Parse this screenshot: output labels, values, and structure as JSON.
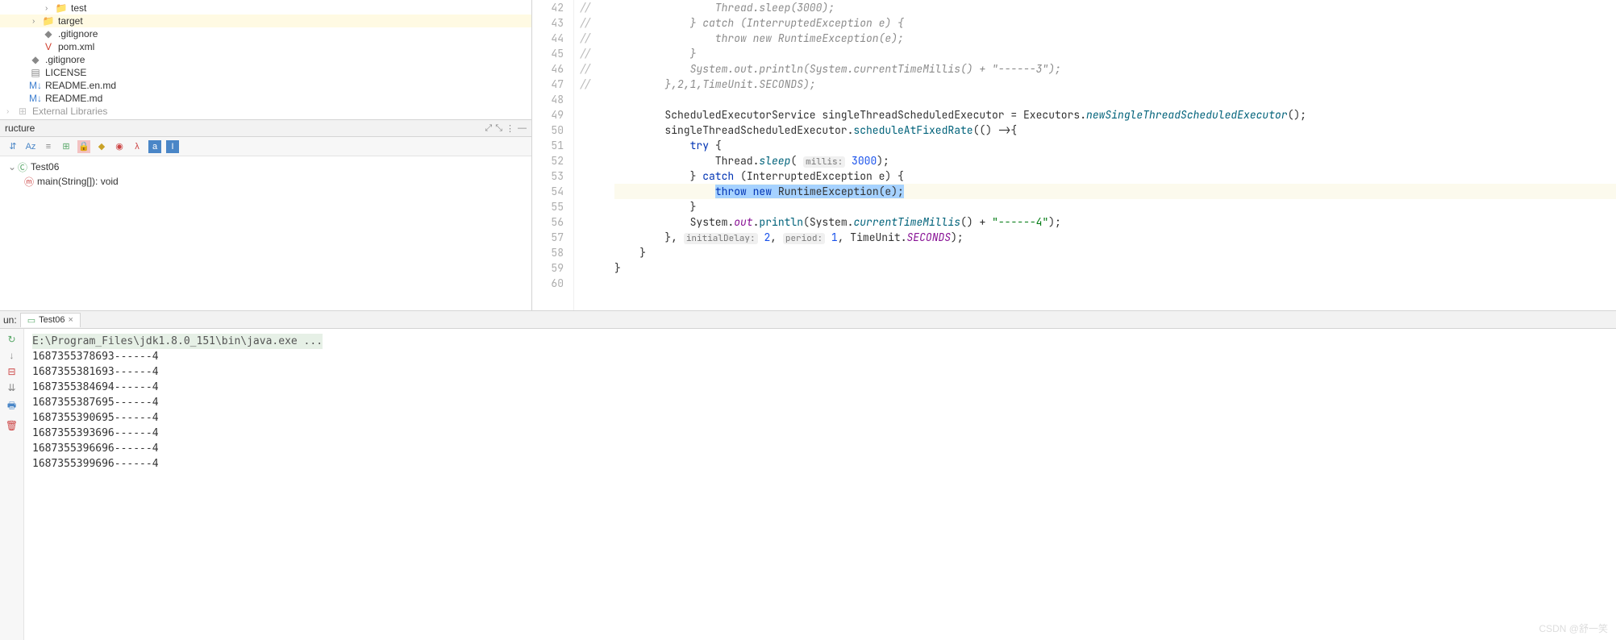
{
  "tree": {
    "items": [
      {
        "indent": 3,
        "arrow": "›",
        "iconClass": "folder-green",
        "glyph": "📁",
        "label": "test"
      },
      {
        "indent": 2,
        "arrow": "›",
        "iconClass": "folder-orange",
        "glyph": "📁",
        "label": "target",
        "sel": true
      },
      {
        "indent": 2,
        "arrow": "",
        "iconClass": "file-gray",
        "glyph": "◆",
        "label": ".gitignore"
      },
      {
        "indent": 2,
        "arrow": "",
        "iconClass": "file-red",
        "glyph": "V",
        "label": "pom.xml"
      },
      {
        "indent": 1,
        "arrow": "",
        "iconClass": "file-gray",
        "glyph": "◆",
        "label": ".gitignore"
      },
      {
        "indent": 1,
        "arrow": "",
        "iconClass": "file-gray",
        "glyph": "▤",
        "label": "LICENSE"
      },
      {
        "indent": 1,
        "arrow": "",
        "iconClass": "file-blue",
        "glyph": "M↓",
        "label": "README.en.md"
      },
      {
        "indent": 1,
        "arrow": "",
        "iconClass": "file-blue",
        "glyph": "M↓",
        "label": "README.md"
      },
      {
        "indent": 0,
        "arrow": "›",
        "iconClass": "file-gray",
        "glyph": "⊞",
        "label": "External Libraries",
        "faded": true
      }
    ]
  },
  "structure": {
    "title": "ructure",
    "className": "Test06",
    "method": "main(String[]): void"
  },
  "editor": {
    "startLine": 42,
    "lines": [
      {
        "n": 42,
        "prefix": "//",
        "html": "<span class='com'>                Thread.sleep(3000);</span>"
      },
      {
        "n": 43,
        "prefix": "//",
        "html": "<span class='com'>            } catch (InterruptedException e) {</span>"
      },
      {
        "n": 44,
        "prefix": "//",
        "html": "<span class='com'>                throw new RuntimeException(e);</span>"
      },
      {
        "n": 45,
        "prefix": "//",
        "html": "<span class='com'>            }</span>"
      },
      {
        "n": 46,
        "prefix": "//",
        "html": "<span class='com'>            System.out.println(System.currentTimeMillis() + \"------3\");</span>"
      },
      {
        "n": 47,
        "prefix": "//",
        "html": "<span class='com'>        },2,1,TimeUnit.SECONDS);</span>"
      },
      {
        "n": 48,
        "prefix": "",
        "html": ""
      },
      {
        "n": 49,
        "prefix": "",
        "html": "        ScheduledExecutorService singleThreadScheduledExecutor = Executors.<span class='methodi'>newSingleThreadScheduledExecutor</span>();"
      },
      {
        "n": 50,
        "prefix": "",
        "html": "        singleThreadScheduledExecutor.<span class='method'>scheduleAtFixedRate</span>(() -&gt;{"
      },
      {
        "n": 51,
        "prefix": "",
        "html": "            <span class='kw'>try</span> {"
      },
      {
        "n": 52,
        "prefix": "",
        "html": "                Thread.<span class='methodi'>sleep</span>( <span class='hint'>millis:</span> <span class='num'>3000</span>);"
      },
      {
        "n": 53,
        "prefix": "",
        "html": "            } <span class='kw'>catch</span> (InterruptedException e) {"
      },
      {
        "n": 54,
        "prefix": "",
        "hl": true,
        "html": "                <span class='sel-text'><span class='kw'>throw new</span> RuntimeException(e);</span>"
      },
      {
        "n": 55,
        "prefix": "",
        "html": "            }"
      },
      {
        "n": 56,
        "prefix": "",
        "html": "            System.<span class='field'>out</span>.<span class='method'>println</span>(System.<span class='methodi'>currentTimeMillis</span>() + <span class='str'>\"------4\"</span>);"
      },
      {
        "n": 57,
        "prefix": "",
        "html": "        }, <span class='hint'>initialDelay:</span> <span class='num'>2</span>, <span class='hint'>period:</span> <span class='num'>1</span>, TimeUnit.<span class='field'>SECONDS</span>);"
      },
      {
        "n": 58,
        "prefix": "",
        "html": "    }"
      },
      {
        "n": 59,
        "prefix": "",
        "html": "}"
      },
      {
        "n": 60,
        "prefix": "",
        "html": ""
      }
    ]
  },
  "run": {
    "label": "un:",
    "tab": "Test06",
    "command": "E:\\Program_Files\\jdk1.8.0_151\\bin\\java.exe ...",
    "output": [
      "1687355378693------4",
      "1687355381693------4",
      "1687355384694------4",
      "1687355387695------4",
      "1687355390695------4",
      "1687355393696------4",
      "1687355396696------4",
      "1687355399696------4"
    ]
  },
  "watermark": "CSDN @舒一笑"
}
